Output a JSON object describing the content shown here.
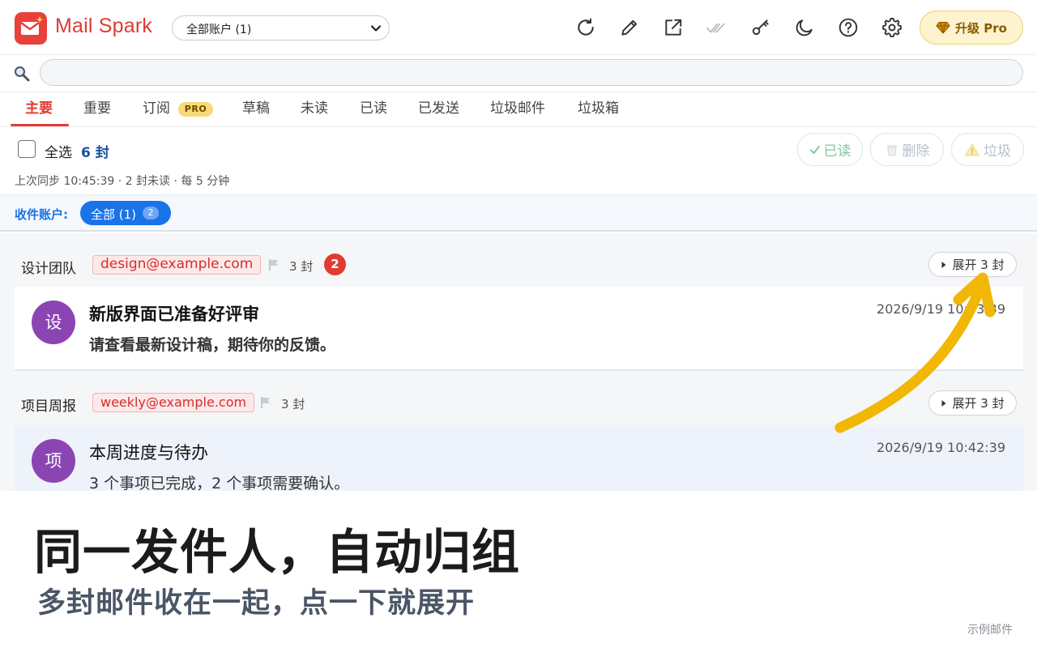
{
  "app": {
    "title": "Mail Spark"
  },
  "header": {
    "account_select": {
      "value": "全部账户 (1)"
    },
    "icons": [
      "refresh-icon",
      "compose-icon",
      "open-external-icon",
      "mark-all-read-icon",
      "key-icon",
      "dark-mode-icon",
      "help-icon",
      "settings-icon"
    ],
    "upgrade_label": "升级 Pro"
  },
  "search": {
    "placeholder": "",
    "value": ""
  },
  "tabs": [
    {
      "label": "主要",
      "active": true
    },
    {
      "label": "重要"
    },
    {
      "label": "订阅",
      "badge": "PRO"
    },
    {
      "label": "草稿"
    },
    {
      "label": "未读"
    },
    {
      "label": "已读"
    },
    {
      "label": "已发送"
    },
    {
      "label": "垃圾邮件"
    },
    {
      "label": "垃圾箱"
    }
  ],
  "toolbar": {
    "select_all_label": "全选",
    "count_label": "6 封",
    "sync_info": "上次同步 10:45:39 · 2 封未读 · 每 5 分钟",
    "mark_read_label": "已读",
    "delete_label": "删除",
    "spam_label": "垃圾"
  },
  "account_filter": {
    "label": "收件账户:",
    "chip_label": "全部 (1)",
    "chip_count": "2"
  },
  "groups": [
    {
      "name": "设计团队",
      "email": "design@example.com",
      "count": "3 封",
      "unread": "2",
      "expand_label": "展开 3 封",
      "mail": {
        "avatar": "设",
        "subject": "新版界面已准备好评审",
        "snippet": "请查看最新设计稿，期待你的反馈。",
        "time": "2026/9/19 10:43:39",
        "unread": true
      }
    },
    {
      "name": "项目周报",
      "email": "weekly@example.com",
      "count": "3 封",
      "expand_label": "展开 3 封",
      "mail": {
        "avatar": "项",
        "subject": "本周进度与待办",
        "snippet": "3 个事项已完成，2 个事项需要确认。",
        "time": "2026/9/19 10:42:39",
        "unread": false
      }
    }
  ],
  "caption": {
    "headline": "同一发件人，自动归组",
    "subline": "多封邮件收在一起，点一下就展开",
    "note": "示例邮件"
  },
  "colors": {
    "brand": "#e03b33",
    "accent_blue": "#1a73e8",
    "avatar": "#8b45b3",
    "arrow": "#f2b705"
  }
}
